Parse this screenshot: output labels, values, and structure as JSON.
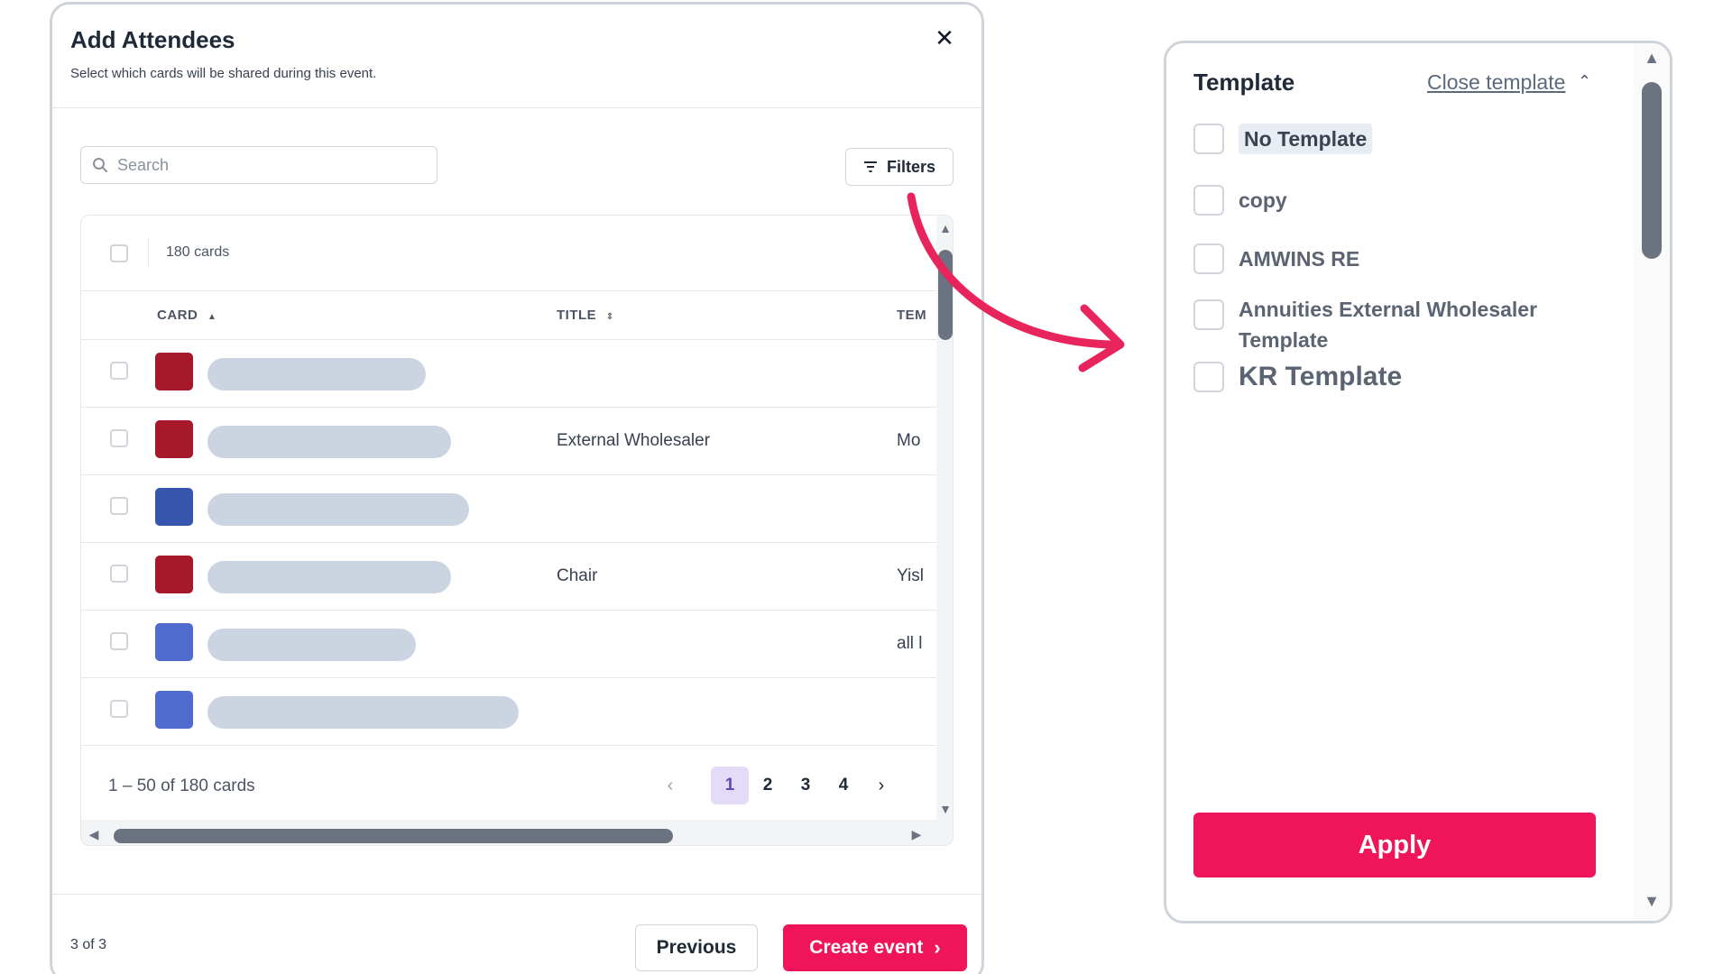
{
  "modal": {
    "title": "Add Attendees",
    "subtitle": "Select which cards will be shared during this event.",
    "close_icon": "close-icon",
    "search": {
      "placeholder": "Search",
      "icon": "search-icon"
    },
    "filters_label": "Filters",
    "table": {
      "count_label": "180 cards",
      "columns": [
        {
          "label": "CARD",
          "sort": "ascending"
        },
        {
          "label": "TITLE",
          "sort": "unsorted"
        },
        {
          "label": "TEM"
        }
      ],
      "rows": [
        {
          "color": "#a5192b",
          "title": "",
          "tem": ""
        },
        {
          "color": "#a5192b",
          "title": "External Wholesaler",
          "tem": "Mo"
        },
        {
          "color": "#3656ae",
          "title": "",
          "tem": ""
        },
        {
          "color": "#a5192b",
          "title": "Chair",
          "tem": "Yisl"
        },
        {
          "color": "#4f6bd0",
          "title": "",
          "tem": "all l"
        },
        {
          "color": "#4f6bd0",
          "title": "",
          "tem": ""
        }
      ]
    },
    "pagination": {
      "range_label": "1 – 50 of 180 cards",
      "pages": [
        "1",
        "2",
        "3",
        "4"
      ],
      "current_page": "1"
    },
    "footer": {
      "step_label": "3 of 3",
      "previous_label": "Previous",
      "create_label": "Create event"
    }
  },
  "template_panel": {
    "title": "Template",
    "close_link": "Close template",
    "options": [
      {
        "label": "No Template",
        "checked": false
      },
      {
        "label": "copy",
        "checked": false
      },
      {
        "label": "AMWINS RE",
        "checked": false
      },
      {
        "label_line1": "Annuities External Wholesaler",
        "label_line2": "Template",
        "checked": false
      },
      {
        "label": "KR Template",
        "checked": false
      }
    ],
    "apply_label": "Apply"
  },
  "colors": {
    "primary": "#f0145a",
    "pagination_active_bg": "#e3dbf7",
    "arrow": "#e8245c"
  }
}
